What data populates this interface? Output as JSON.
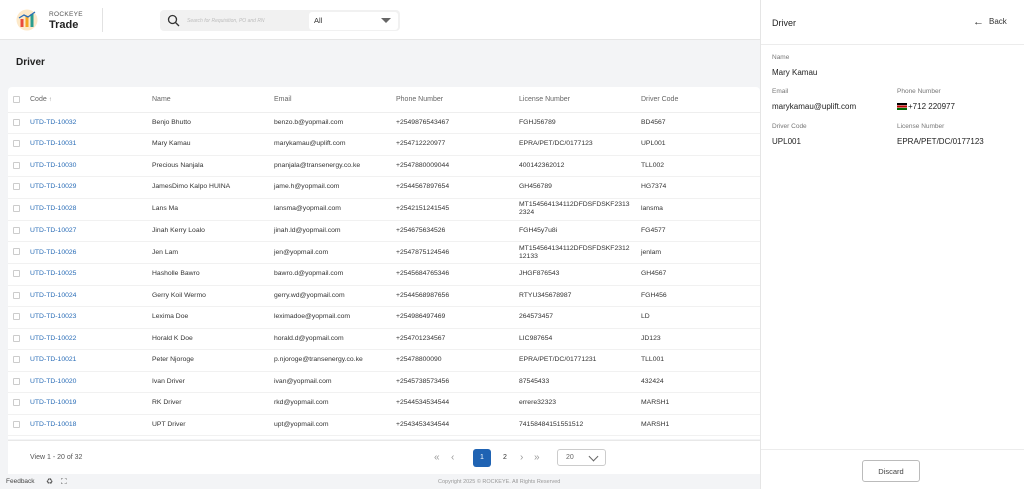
{
  "header": {
    "brand_top": "ROCKEYE",
    "brand_main": "Trade",
    "search_placeholder": "Search for Requisition, PO and RN",
    "filter_value": "All"
  },
  "page": {
    "title": "Driver"
  },
  "table": {
    "columns": {
      "code": "Code",
      "name": "Name",
      "email": "Email",
      "phone": "Phone Number",
      "license": "License Number",
      "driver_code": "Driver Code"
    },
    "rows": [
      {
        "code": "UTD-TD-10032",
        "name": "Benjo Bhutto",
        "email": "benzo.b@yopmail.com",
        "phone": "+2549876543467",
        "license": "FGHJ56789",
        "driver_code": "BD4567"
      },
      {
        "code": "UTD-TD-10031",
        "name": "Mary Kamau",
        "email": "marykamau@uplift.com",
        "phone": "+254712220977",
        "license": "EPRA/PET/DC/0177123",
        "driver_code": "UPL001"
      },
      {
        "code": "UTD-TD-10030",
        "name": "Precious Nanjala",
        "email": "pnanjala@transenergy.co.ke",
        "phone": "+25478800090​44",
        "license": "400142362012",
        "driver_code": "TLL002"
      },
      {
        "code": "UTD-TD-10029",
        "name": "JamesDimo Kalpo HUINA",
        "email": "jame.h@yopmail.com",
        "phone": "+2544567897654",
        "license": "GH456789",
        "driver_code": "HG7374"
      },
      {
        "code": "UTD-TD-10028",
        "name": "Lans Ma",
        "email": "lansma@yopmail.com",
        "phone": "+2542151241545",
        "license_line1": "MT154564134112DFDSFDSKF2313",
        "license_line2": "2324",
        "driver_code": "lansma"
      },
      {
        "code": "UTD-TD-10027",
        "name": "Jinah Kerry Loalo",
        "email": "jinah.ld@yopmail.com",
        "phone": "+254675634526",
        "license": "FGH45y7u8i",
        "driver_code": "FG4577"
      },
      {
        "code": "UTD-TD-10026",
        "name": "Jen Lam",
        "email": "jen@yopmail.com",
        "phone": "+2547875124546",
        "license_line1": "MT154564134112DFDSFDSKF2312",
        "license_line2": "12133",
        "driver_code": "jenlam"
      },
      {
        "code": "UTD-TD-10025",
        "name": "Hasholle Bawro",
        "email": "bawro.d@yopmail.com",
        "phone": "+2545684765346",
        "license": "JHGF876543",
        "driver_code": "GH4567"
      },
      {
        "code": "UTD-TD-10024",
        "name": "Gerry Koil Wermo",
        "email": "gerry.wd@yopmail.com",
        "phone": "+2544568987656",
        "license": "RTYU345678987",
        "driver_code": "FGH456"
      },
      {
        "code": "UTD-TD-10023",
        "name": "Lexima Doe",
        "email": "leximadoe@yopmail.com",
        "phone": "+254986497469",
        "license": "264573457",
        "driver_code": "LD"
      },
      {
        "code": "UTD-TD-10022",
        "name": "Horald K Doe",
        "email": "horald.d@yopmail.com",
        "phone": "+254701234567",
        "license": "LIC987654",
        "driver_code": "JD123"
      },
      {
        "code": "UTD-TD-10021",
        "name": "Peter Njoroge",
        "email": "p.njoroge@transenergy.co.ke",
        "phone": "+25478800090",
        "license": "EPRA/PET/DC/01771231",
        "driver_code": "TLL001"
      },
      {
        "code": "UTD-TD-10020",
        "name": "Ivan Driver",
        "email": "ivan@yopmail.com",
        "phone": "+2545738573456",
        "license": "87545433",
        "driver_code": "432424"
      },
      {
        "code": "UTD-TD-10019",
        "name": "RK Driver",
        "email": "rkd@yopmail.com",
        "phone": "+2544534534544",
        "license": "errere32323",
        "driver_code": "MARSH1"
      },
      {
        "code": "UTD-TD-10018",
        "name": "UPT Driver",
        "email": "upt@yopmail.com",
        "phone": "+2543453434544",
        "license": "74158484151551512",
        "driver_code": "MARSH1"
      }
    ]
  },
  "pagination": {
    "view_text": "View 1 - 20 of 32",
    "first": "«",
    "prev": "‹",
    "page1": "1",
    "page2": "2",
    "next": "›",
    "last": "»",
    "page_size": "20"
  },
  "bottom": {
    "feedback": "Feedback",
    "copyright": "Copyright 2025 © ROCKEYE. All Rights Reserved"
  },
  "side_panel": {
    "title": "Driver",
    "back": "Back",
    "name_label": "Name",
    "name_value": "Mary Kamau",
    "email_label": "Email",
    "email_value": "marykamau@uplift.com",
    "phone_label": "Phone Number",
    "phone_value": "+712 220977",
    "driver_code_label": "Driver Code",
    "driver_code_value": "UPL001",
    "license_label": "License Number",
    "license_value": "EPRA/PET/DC/0177123",
    "discard": "Discard"
  },
  "colors": {
    "accent": "#1f63b3",
    "link": "#2a6db7"
  }
}
